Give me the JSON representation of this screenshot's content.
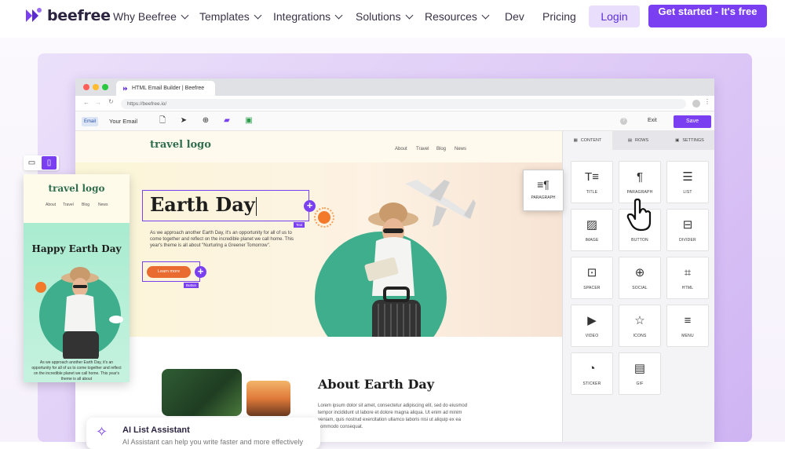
{
  "header": {
    "brand": "beefree",
    "nav": [
      {
        "label": "Why Beefree",
        "dropdown": true
      },
      {
        "label": "Templates",
        "dropdown": true
      },
      {
        "label": "Integrations",
        "dropdown": true
      },
      {
        "label": "Solutions",
        "dropdown": true
      },
      {
        "label": "Resources",
        "dropdown": true
      },
      {
        "label": "Dev",
        "dropdown": false
      },
      {
        "label": "Pricing",
        "dropdown": false
      }
    ],
    "login": "Login",
    "cta": "Get started - It's free"
  },
  "colors": {
    "brand": "#7b3ff2",
    "accent_orange": "#ea6b2f",
    "green": "#2f6e4f",
    "teal": "#3fae8d"
  },
  "browser": {
    "tab_title": "HTML Email Builder | Beefree",
    "url": "https://beefree.io/",
    "toolbar": {
      "email_badge": "Email",
      "doc_name": "Your Email",
      "exit": "Exit",
      "save": "Save",
      "icons": [
        "file-icon",
        "send-icon",
        "globe-icon",
        "chat-icon",
        "file-check-icon"
      ]
    }
  },
  "email": {
    "logo": "travel logo",
    "nav": [
      "About",
      "Travel",
      "Blog",
      "News"
    ],
    "hero_title": "Earth Day",
    "title_tag": "Text",
    "hero_text": "As we approach another Earth Day, it's an opportunity for all of us to come together and reflect on the incredible planet we call home. This year's theme is all about \"Nurturing a Greener Tomorrow\".",
    "cta": "Learn more",
    "cta_tag": "Button",
    "about_title": "About Earth Day",
    "about_text": "Lorem ipsum dolor sit amet, consectetur adipiscing elit, sed do eiusmod tempor incididunt ut labore et dolore magna aliqua. Ut enim ad minim veniam, quis nostrud exercitation ullamco laboris nisi ut aliquip ex ea commodo consequat."
  },
  "panel": {
    "tabs": [
      {
        "label": "CONTENT",
        "icon": "grid-icon"
      },
      {
        "label": "ROWS",
        "icon": "rows-icon"
      },
      {
        "label": "SETTINGS",
        "icon": "settings-icon"
      }
    ],
    "blocks": [
      {
        "label": "TITLE",
        "icon": "title-icon",
        "glyph": "T≡"
      },
      {
        "label": "PARAGRAPH",
        "icon": "paragraph-icon",
        "glyph": "¶"
      },
      {
        "label": "LIST",
        "icon": "list-icon",
        "glyph": "☰"
      },
      {
        "label": "IMAGE",
        "icon": "image-icon",
        "glyph": "▨"
      },
      {
        "label": "BUTTON",
        "icon": "button-icon",
        "glyph": "▭"
      },
      {
        "label": "DIVIDER",
        "icon": "divider-icon",
        "glyph": "⊟"
      },
      {
        "label": "SPACER",
        "icon": "spacer-icon",
        "glyph": "⊡"
      },
      {
        "label": "SOCIAL",
        "icon": "social-icon",
        "glyph": "⊕"
      },
      {
        "label": "HTML",
        "icon": "html-icon",
        "glyph": "⌗"
      },
      {
        "label": "VIDEO",
        "icon": "video-icon",
        "glyph": "▶"
      },
      {
        "label": "ICONS",
        "icon": "star-icon",
        "glyph": "☆"
      },
      {
        "label": "MENU",
        "icon": "menu-icon",
        "glyph": "≡"
      },
      {
        "label": "STICKER",
        "icon": "sticker-icon",
        "glyph": "◔"
      },
      {
        "label": "GIF",
        "icon": "gif-icon",
        "glyph": "▤"
      }
    ],
    "dragging_label": "PARAGRAPH"
  },
  "mobile": {
    "logo": "travel logo",
    "nav": [
      "About",
      "Travel",
      "Blog",
      "News"
    ],
    "title": "Happy Earth Day",
    "text": "As we approach another Earth Day, it's an opportunity for all of us to come together and reflect on the incredible planet we call home. This year's theme is all about"
  },
  "ai_assistant": {
    "title": "AI List Assistant",
    "subtitle": "AI Assistant can help you write faster and more effectively"
  }
}
